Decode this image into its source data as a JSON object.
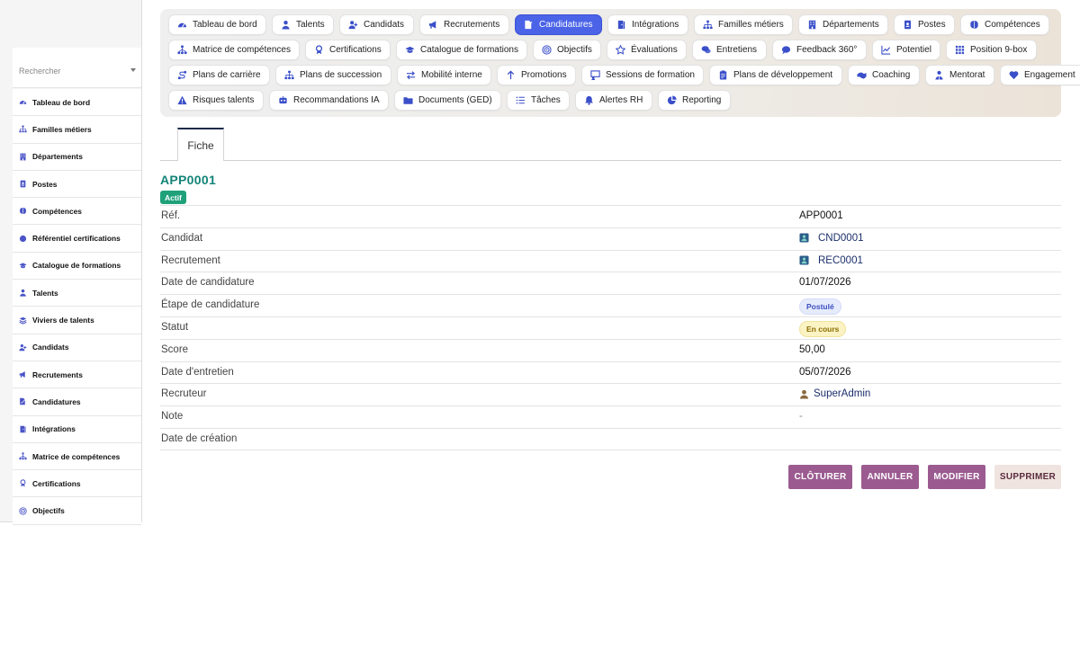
{
  "sidebar": {
    "search_placeholder": "Rechercher",
    "items": [
      {
        "label": "Tableau de bord",
        "icon": "dashboard-icon"
      },
      {
        "label": "Familles métiers",
        "icon": "sitemap-icon"
      },
      {
        "label": "Départements",
        "icon": "building-icon"
      },
      {
        "label": "Postes",
        "icon": "id-badge-icon"
      },
      {
        "label": "Compétences",
        "icon": "brain-icon"
      },
      {
        "label": "Référentiel certifications",
        "icon": "certificate-icon"
      },
      {
        "label": "Catalogue de formations",
        "icon": "graduation-cap-icon"
      },
      {
        "label": "Talents",
        "icon": "user-icon"
      },
      {
        "label": "Viviers de talents",
        "icon": "layers-icon"
      },
      {
        "label": "Candidats",
        "icon": "user-plus-icon"
      },
      {
        "label": "Recrutements",
        "icon": "megaphone-icon"
      },
      {
        "label": "Candidatures",
        "icon": "file-signature-icon"
      },
      {
        "label": "Intégrations",
        "icon": "door-icon"
      },
      {
        "label": "Matrice de compétences",
        "icon": "network-icon"
      },
      {
        "label": "Certifications",
        "icon": "award-icon"
      },
      {
        "label": "Objectifs",
        "icon": "target-icon"
      }
    ]
  },
  "nav": {
    "rows": [
      [
        {
          "label": "Tableau de bord",
          "icon": "dashboard-icon"
        },
        {
          "label": "Talents",
          "icon": "user-icon"
        },
        {
          "label": "Candidats",
          "icon": "user-plus-icon"
        },
        {
          "label": "Recrutements",
          "icon": "megaphone-icon"
        },
        {
          "label": "Candidatures",
          "icon": "file-signature-icon",
          "active": true
        },
        {
          "label": "Intégrations",
          "icon": "door-icon"
        },
        {
          "label": "Familles métiers",
          "icon": "sitemap-icon"
        },
        {
          "label": "Départements",
          "icon": "building-icon"
        },
        {
          "label": "Postes",
          "icon": "id-badge-icon"
        },
        {
          "label": "Compétences",
          "icon": "brain-icon"
        }
      ],
      [
        {
          "label": "Matrice de compétences",
          "icon": "network-icon"
        },
        {
          "label": "Certifications",
          "icon": "award-icon"
        },
        {
          "label": "Catalogue de formations",
          "icon": "graduation-cap-icon"
        },
        {
          "label": "Objectifs",
          "icon": "target-icon"
        },
        {
          "label": "Évaluations",
          "icon": "star-icon"
        },
        {
          "label": "Entretiens",
          "icon": "comments-icon"
        },
        {
          "label": "Feedback 360°",
          "icon": "comment-icon"
        },
        {
          "label": "Potentiel",
          "icon": "chart-line-icon"
        },
        {
          "label": "Position 9-box",
          "icon": "grid-icon"
        }
      ],
      [
        {
          "label": "Plans de carrière",
          "icon": "route-icon"
        },
        {
          "label": "Plans de succession",
          "icon": "sitemap-icon"
        },
        {
          "label": "Mobilité interne",
          "icon": "exchange-icon"
        },
        {
          "label": "Promotions",
          "icon": "arrow-up-icon"
        },
        {
          "label": "Sessions de formation",
          "icon": "chalkboard-icon"
        },
        {
          "label": "Plans de développement",
          "icon": "clipboard-icon"
        },
        {
          "label": "Coaching",
          "icon": "handshake-icon"
        },
        {
          "label": "Mentorat",
          "icon": "mentor-icon"
        },
        {
          "label": "Engagement",
          "icon": "heart-icon"
        }
      ],
      [
        {
          "label": "Risques talents",
          "icon": "warning-icon"
        },
        {
          "label": "Recommandations IA",
          "icon": "robot-icon"
        },
        {
          "label": "Documents (GED)",
          "icon": "folder-icon"
        },
        {
          "label": "Tâches",
          "icon": "list-icon"
        },
        {
          "label": "Alertes RH",
          "icon": "bell-icon"
        },
        {
          "label": "Reporting",
          "icon": "pie-chart-icon"
        }
      ]
    ]
  },
  "tabs": {
    "fiche": "Fiche"
  },
  "record": {
    "title": "APP0001",
    "status_badge": "Actif",
    "fields": [
      {
        "key": "Réf.",
        "value": "APP0001",
        "type": "text"
      },
      {
        "key": "Candidat",
        "value": "CND0001",
        "type": "link",
        "icon": "contact-card-icon"
      },
      {
        "key": "Recrutement",
        "value": "REC0001",
        "type": "link",
        "icon": "contact-card-icon"
      },
      {
        "key": "Date de candidature",
        "value": "01/07/2026",
        "type": "text"
      },
      {
        "key": "Étape de candidature",
        "value": "Postulé",
        "type": "pill-blue"
      },
      {
        "key": "Statut",
        "value": "En cours",
        "type": "pill-yellow"
      },
      {
        "key": "Score",
        "value": "50,00",
        "type": "text"
      },
      {
        "key": "Date d'entretien",
        "value": "05/07/2026",
        "type": "text"
      },
      {
        "key": "Recruteur",
        "value": "SuperAdmin",
        "type": "link",
        "icon": "user-avatar-icon"
      },
      {
        "key": "Note",
        "value": "-",
        "type": "dash"
      },
      {
        "key": "Date de création",
        "value": "",
        "type": "text"
      }
    ]
  },
  "actions": {
    "cloturer": "CLÔTURER",
    "annuler": "ANNULER",
    "modifier": "MODIFIER",
    "supprimer": "SUPPRIMER"
  },
  "colors": {
    "accent": "#4a63e7",
    "title": "#138477",
    "badge": "#1fa17a",
    "action": "#9b5b90"
  }
}
